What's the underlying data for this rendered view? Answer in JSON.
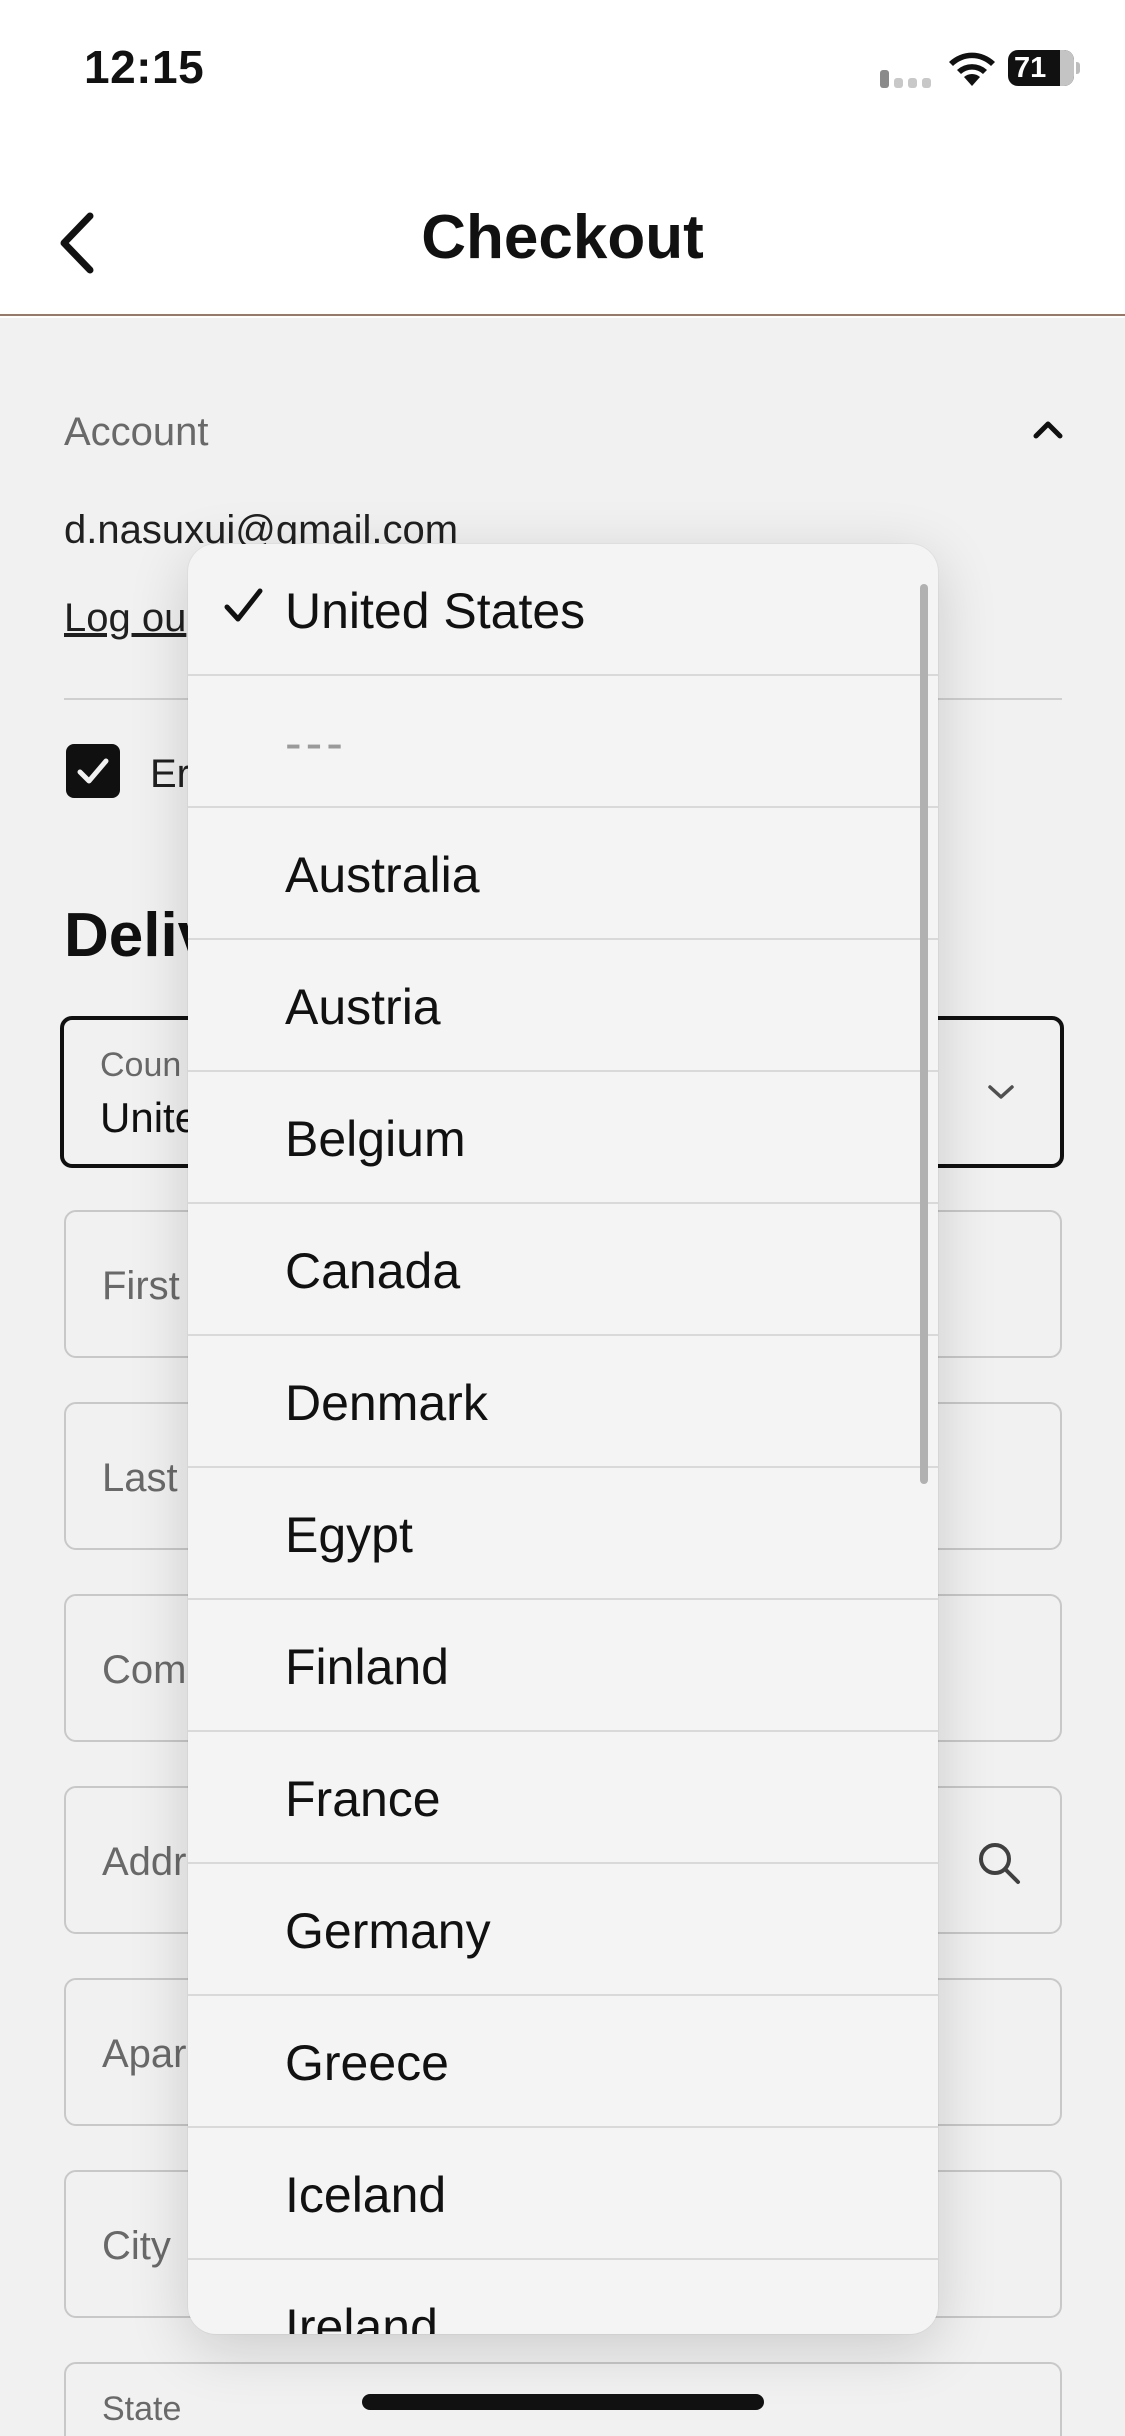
{
  "status_bar": {
    "time": "12:15",
    "battery": "71"
  },
  "header": {
    "title": "Checkout",
    "back_icon": "chevron-left-icon"
  },
  "account": {
    "section_label": "Account",
    "email": "d.nasuxui@gmail.com",
    "logout_label": "Log ou",
    "email_offers_label": "Er",
    "email_offers_checked": true
  },
  "delivery": {
    "heading": "Deliv",
    "country_label": "Coun",
    "country_value": "Unite",
    "first_name_placeholder": "First",
    "last_name_placeholder": "Last",
    "company_placeholder": "Com",
    "address_placeholder": "Addr",
    "apartment_placeholder": "Apar",
    "city_placeholder": "City",
    "state_label": "State"
  },
  "country_picker": {
    "selected": "United States",
    "options": [
      "United States",
      "---",
      "Australia",
      "Austria",
      "Belgium",
      "Canada",
      "Denmark",
      "Egypt",
      "Finland",
      "France",
      "Germany",
      "Greece",
      "Iceland",
      "Ireland"
    ]
  },
  "colors": {
    "header_divider": "#9b7766",
    "text": "#111111",
    "muted": "#707070"
  }
}
